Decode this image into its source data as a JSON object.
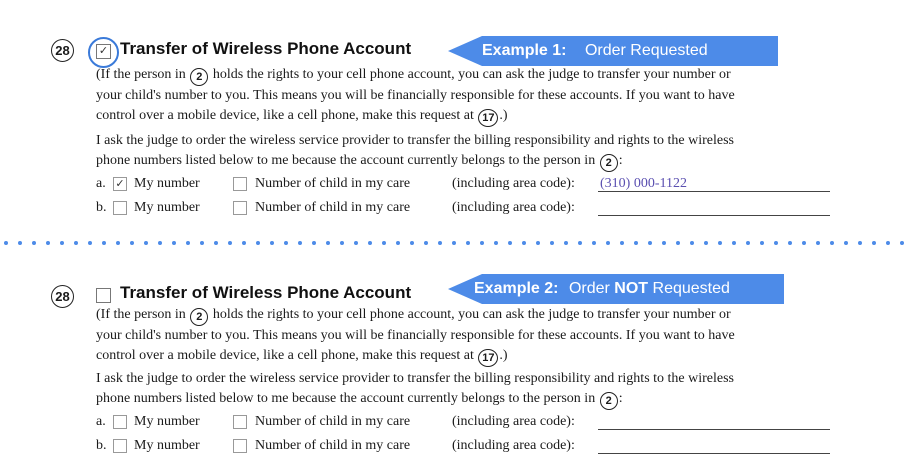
{
  "example1": {
    "number": "28",
    "title_checked": true,
    "title": "Transfer of Wireless Phone Account",
    "callout_label": "Example 1:",
    "callout_value": "Order Requested",
    "para1": {
      "line1_a": "(If the person in",
      "ref_a": "2",
      "line1_b": "holds the rights to your cell phone account, you can ask the judge to transfer your number or",
      "line2": "your child's number to you. This means you will be financially responsible for these accounts. If you want to have",
      "line3_a": "control over a mobile device, like a cell phone, make this request at",
      "ref_b": "17",
      "line3_b": ".)"
    },
    "para2": {
      "line1": "I ask the judge to order the wireless service provider to transfer the billing responsibility and rights to the wireless",
      "line2_a": "phone numbers listed below to me because the account currently belongs to the person in",
      "ref": "2",
      "line2_b": ":"
    },
    "options": [
      {
        "letter": "a.",
        "my_number_checked": true,
        "child_checked": false,
        "my_number_label": "My number",
        "child_label": "Number of child in my care",
        "area_label": "(including area code):",
        "phone": "(310) 000-1122"
      },
      {
        "letter": "b.",
        "my_number_checked": false,
        "child_checked": false,
        "my_number_label": "My number",
        "child_label": "Number of child in my care",
        "area_label": "(including area code):",
        "phone": ""
      }
    ]
  },
  "example2": {
    "number": "28",
    "title_checked": false,
    "title": "Transfer of Wireless Phone Account",
    "callout_label": "Example 2:",
    "callout_pre": "Order",
    "callout_emph": "NOT",
    "callout_post": "Requested",
    "para1": {
      "line1_a": "(If the person in",
      "ref_a": "2",
      "line1_b": "holds the rights to your cell phone account, you can ask the judge to transfer your number or",
      "line2": "your child's number to you. This means you will be financially responsible for these accounts. If you want to have",
      "line3_a": "control over a mobile device, like a cell phone, make this request at",
      "ref_b": "17",
      "line3_b": ".)"
    },
    "para2": {
      "line1": "I ask the judge to order the wireless service provider to transfer the billing responsibility and rights to the wireless",
      "line2_a": "phone numbers listed below to me because the account currently belongs to the person in",
      "ref": "2",
      "line2_b": ":"
    },
    "options": [
      {
        "letter": "a.",
        "my_number_checked": false,
        "child_checked": false,
        "my_number_label": "My number",
        "child_label": "Number of child in my care",
        "area_label": "(including area code):",
        "phone": ""
      },
      {
        "letter": "b.",
        "my_number_checked": false,
        "child_checked": false,
        "my_number_label": "My number",
        "child_label": "Number of child in my care",
        "area_label": "(including area code):",
        "phone": ""
      }
    ]
  },
  "colors": {
    "accent": "#4d8be8",
    "ring": "#3a7ad9",
    "filled_value": "#5a4fb0"
  }
}
